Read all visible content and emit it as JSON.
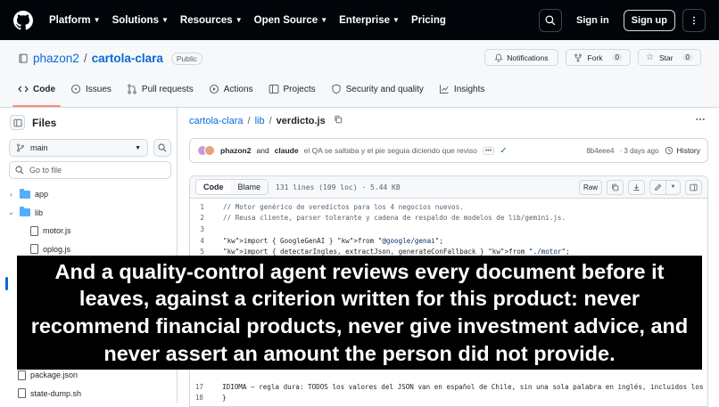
{
  "topbar": {
    "nav": [
      {
        "label": "Platform"
      },
      {
        "label": "Solutions"
      },
      {
        "label": "Resources"
      },
      {
        "label": "Open Source"
      },
      {
        "label": "Enterprise"
      },
      {
        "label": "Pricing"
      }
    ],
    "signin": "Sign in",
    "signup": "Sign up"
  },
  "repo": {
    "owner": "phazon2",
    "slash": "/",
    "name": "cartola-clara",
    "visibility": "Public",
    "notifications": "Notifications",
    "fork_label": "Fork",
    "fork_count": "0",
    "star_label": "Star",
    "star_count": "0"
  },
  "tabs": [
    {
      "label": "Code",
      "icon": "code-icon"
    },
    {
      "label": "Issues",
      "icon": "issue-icon"
    },
    {
      "label": "Pull requests",
      "icon": "pull-request-icon"
    },
    {
      "label": "Actions",
      "icon": "play-icon"
    },
    {
      "label": "Projects",
      "icon": "table-icon"
    },
    {
      "label": "Security and quality",
      "icon": "shield-icon"
    },
    {
      "label": "Insights",
      "icon": "graph-icon"
    }
  ],
  "sidebar": {
    "title": "Files",
    "branch": "main",
    "goto_placeholder": "Go to file",
    "tree": [
      {
        "label": "app",
        "type": "folder",
        "expanded": false
      },
      {
        "label": "lib",
        "type": "folder",
        "expanded": true
      },
      {
        "label": "motor.js",
        "type": "file"
      },
      {
        "label": "oplog.js",
        "type": "file"
      }
    ],
    "tree_bottom": [
      {
        "label": "package.json",
        "type": "file"
      },
      {
        "label": "state-dump.sh",
        "type": "file"
      }
    ]
  },
  "breadcrumb": {
    "repo": "cartola-clara",
    "folder": "lib",
    "file": "verdicto.js"
  },
  "commit": {
    "author1": "phazon2",
    "and": "and",
    "author2": "claude",
    "message": "el QA se saltaba y el pie seguia diciendo que reviso",
    "sha": "8b4eee4",
    "time": "· 3 days ago",
    "history": "History"
  },
  "file": {
    "code_tab": "Code",
    "blame_tab": "Blame",
    "meta": "131 lines (109 loc) · 5.44 KB",
    "raw": "Raw",
    "lines": [
      {
        "n": "1",
        "text": "// Motor genérico de veredictos para los 4 negocios nuevos.",
        "kind": "comment"
      },
      {
        "n": "2",
        "text": "// Reusa cliente, parser tolerante y cadena de respaldo de modelos de lib/gemini.js.",
        "kind": "comment"
      },
      {
        "n": "3",
        "text": "",
        "kind": "plain"
      },
      {
        "n": "4",
        "text": "import { GoogleGenAI } from \"@google/genai\";",
        "kind": "import"
      },
      {
        "n": "5",
        "text": "import { detectarIngles, extractJson, generateConFallback } from \"./motor\";",
        "kind": "import"
      }
    ],
    "tail_lines": [
      {
        "n": "17",
        "text": "IDIOMA — regla dura: TODOS los valores del JSON van en español de Chile, sin una sola palabra en inglés, incluidos los",
        "kind": "plain"
      },
      {
        "n": "18",
        "text": "}",
        "kind": "plain"
      }
    ]
  },
  "overlay": {
    "caption": "And a quality-control agent reviews every document before it leaves, against a criterion written for this product: never recommend financial products, never give investment advice, and never assert an amount the person did not provide."
  }
}
